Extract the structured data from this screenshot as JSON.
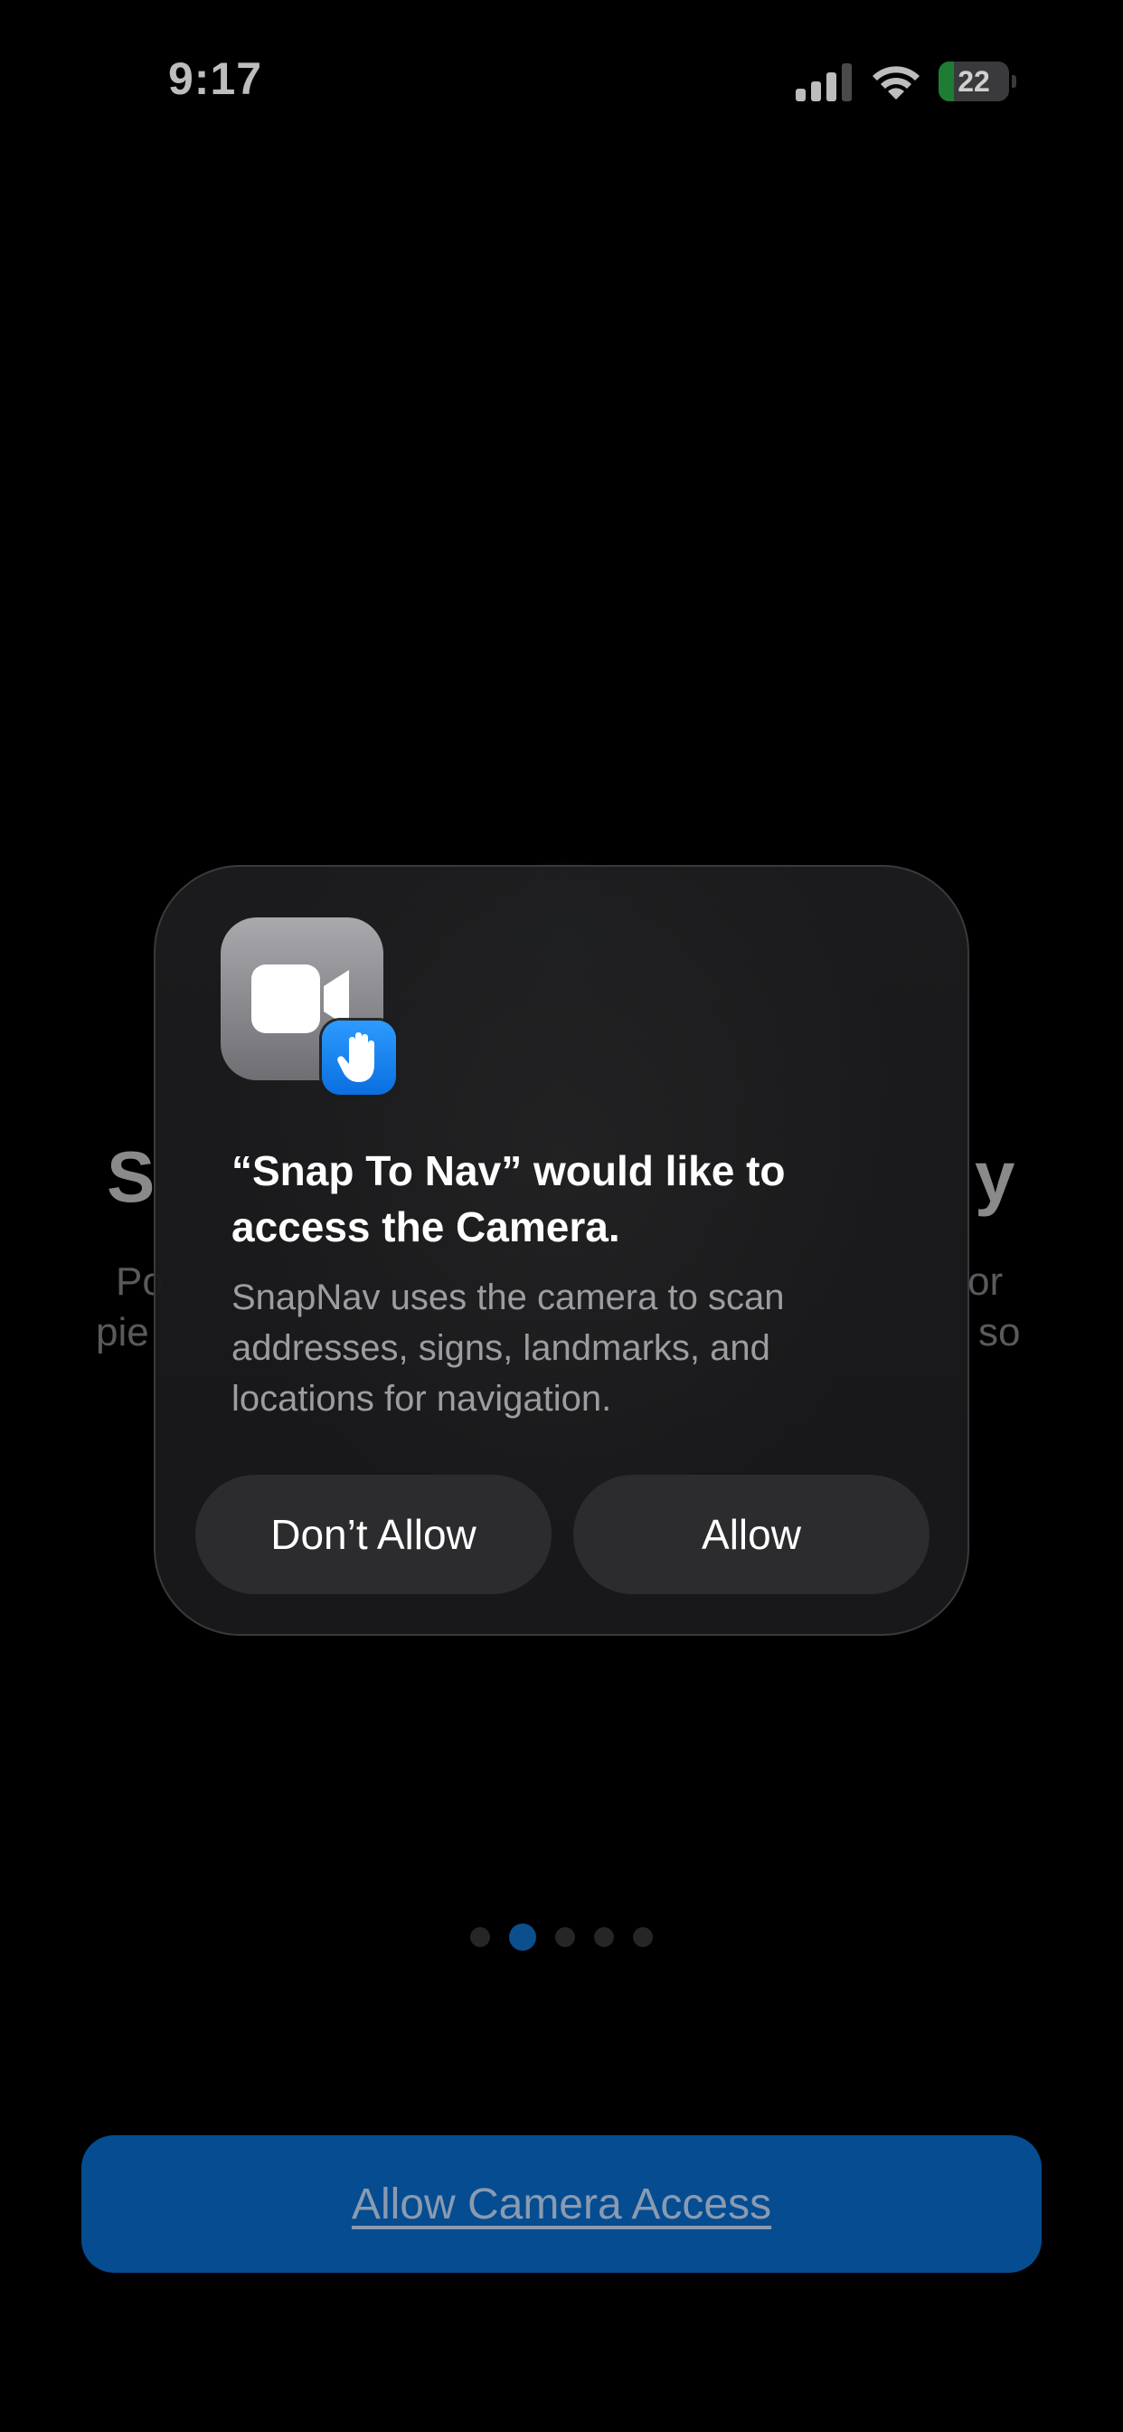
{
  "status_bar": {
    "time": "9:17",
    "battery_level": "22",
    "battery_fraction": 0.22,
    "icons": [
      "signal-icon",
      "wifi-icon",
      "battery-charging-icon"
    ]
  },
  "background_page": {
    "heading_left_fragment": "S",
    "heading_right_fragment": "y",
    "body_line1_left": "Po",
    "body_line1_right": "or",
    "body_line2_left": "pie",
    "body_line2_right": "so",
    "pager": {
      "count": 5,
      "active_index": 1
    },
    "cta_label": "Allow Camera Access"
  },
  "alert": {
    "app_icon": "facetime-camera-icon",
    "badge_icon": "privacy-hand-icon",
    "title": "“Snap To Nav” would like to access the Camera.",
    "message": "SnapNav uses the camera to scan addresses, signs, landmarks, and locations for navigation.",
    "dont_allow_label": "Don’t Allow",
    "allow_label": "Allow"
  },
  "colors": {
    "background": "#000000",
    "alert_surface": "#1c1c1e",
    "alert_button": "#2c2c2e",
    "accent_blue": "#064c91",
    "badge_blue": "#0a84ff",
    "battery_green": "#1f7d33"
  }
}
